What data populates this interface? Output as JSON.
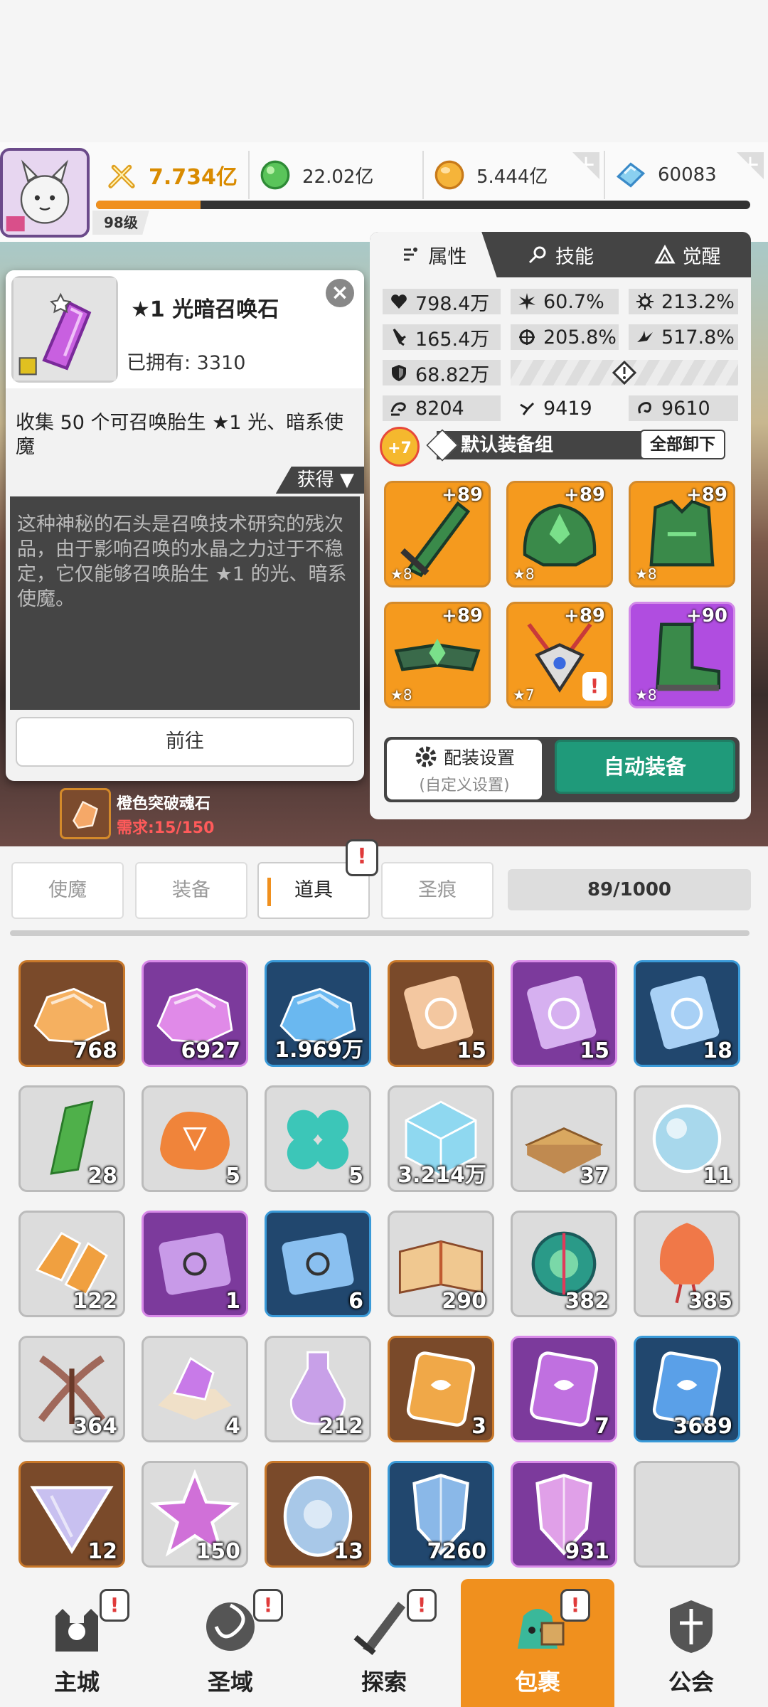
{
  "player": {
    "level": "98级"
  },
  "resources": {
    "power": "7.734亿",
    "green_gem": "22.02亿",
    "gold": "5.444亿",
    "diamond": "60083",
    "xp_progress": 0.16
  },
  "popup": {
    "title": "★1 光暗召唤石",
    "owned": "已拥有: 3310",
    "close": "×",
    "desc": "收集 50 个可召唤胎生 ★1 光、暗系使魔",
    "get_label": "获得 ▼",
    "lore": "这种神秘的石头是召唤技术研究的残次品，由于影响召唤的水晶之力过于不稳定，它仅能够召唤胎生 ★1 的光、暗系使魔。",
    "go_button": "前往"
  },
  "hint": {
    "name": "橙色突破魂石",
    "need": "需求:15/150"
  },
  "panel": {
    "tabs": [
      {
        "label": "属性",
        "icon": "attribute-icon"
      },
      {
        "label": "技能",
        "icon": "skill-icon"
      },
      {
        "label": "觉醒",
        "icon": "awaken-icon"
      }
    ],
    "stats": {
      "hp": "798.4万",
      "crit_rate": "60.7%",
      "crit_dmg": "213.2%",
      "atk": "165.4万",
      "accuracy": "205.8%",
      "speed_pct": "517.8%",
      "def": "68.82万",
      "s1": "8204",
      "s2": "9419",
      "s3": "9610"
    },
    "enhance": "+7",
    "equip_set": "默认装备组",
    "unequip_all": "全部卸下",
    "equipment": [
      {
        "level": "+89",
        "stars": "★8",
        "rarity": "orange",
        "icon": "sword-icon"
      },
      {
        "level": "+89",
        "stars": "★8",
        "rarity": "orange",
        "icon": "helmet-icon"
      },
      {
        "level": "+89",
        "stars": "★8",
        "rarity": "orange",
        "icon": "armor-icon"
      },
      {
        "level": "+89",
        "stars": "★8",
        "rarity": "orange",
        "icon": "belt-icon"
      },
      {
        "level": "+89",
        "stars": "★7",
        "rarity": "orange",
        "icon": "necklace-icon",
        "warn": "!"
      },
      {
        "level": "+90",
        "stars": "★8",
        "rarity": "purple",
        "icon": "boots-icon"
      }
    ],
    "config_label": "配装设置",
    "config_sub": "(自定义设置)",
    "auto_equip": "自动装备"
  },
  "inventory": {
    "categories": [
      "使魔",
      "装备",
      "道具",
      "圣痕"
    ],
    "active": "道具",
    "badge": "!",
    "capacity": "89/1000",
    "items": [
      {
        "count": "768",
        "rarity": "orange",
        "icon": "ore-icon",
        "color": "#f5b060"
      },
      {
        "count": "6927",
        "rarity": "purple",
        "icon": "ore-icon",
        "color": "#e08ae8"
      },
      {
        "count": "1.969万",
        "rarity": "blue",
        "icon": "ore-icon",
        "color": "#6ab8f0"
      },
      {
        "count": "15",
        "rarity": "orange",
        "icon": "scroll-icon",
        "color": "#f3c7a0"
      },
      {
        "count": "15",
        "rarity": "purple",
        "icon": "scroll-icon",
        "color": "#d6b0f0"
      },
      {
        "count": "18",
        "rarity": "blue",
        "icon": "scroll-icon",
        "color": "#a8d0f5"
      },
      {
        "count": "28",
        "rarity": "grey",
        "icon": "crystal-icon",
        "color": "#4fb04a"
      },
      {
        "count": "5",
        "rarity": "grey",
        "icon": "fire-scroll-icon",
        "color": "#f0843a"
      },
      {
        "count": "5",
        "rarity": "grey",
        "icon": "clover-icon",
        "color": "#3cc6b8"
      },
      {
        "count": "3.214万",
        "rarity": "grey",
        "icon": "cube-icon",
        "color": "#8fd8f0"
      },
      {
        "count": "37",
        "rarity": "grey",
        "icon": "book-icon",
        "color": "#d9a860"
      },
      {
        "count": "11",
        "rarity": "grey",
        "icon": "orb-icon",
        "color": "#a8d8ec"
      },
      {
        "count": "122",
        "rarity": "grey",
        "icon": "shard-icon",
        "color": "#f0a040"
      },
      {
        "count": "1",
        "rarity": "purple",
        "icon": "rune-scroll-icon",
        "color": "#c89ae8"
      },
      {
        "count": "6",
        "rarity": "blue",
        "icon": "rune-scroll-icon",
        "color": "#8ac0f0"
      },
      {
        "count": "290",
        "rarity": "grey",
        "icon": "open-book-icon",
        "color": "#f0c890"
      },
      {
        "count": "382",
        "rarity": "grey",
        "icon": "compass-icon",
        "color": "#2a9a88"
      },
      {
        "count": "385",
        "rarity": "grey",
        "icon": "lantern-icon",
        "color": "#f07848"
      },
      {
        "count": "364",
        "rarity": "grey",
        "icon": "crossbow-icon",
        "color": "#a0685a"
      },
      {
        "count": "4",
        "rarity": "grey",
        "icon": "gem-pile-icon",
        "color": "#c87ae8"
      },
      {
        "count": "212",
        "rarity": "grey",
        "icon": "potion-icon",
        "color": "#c8a0e8"
      },
      {
        "count": "3",
        "rarity": "orange",
        "icon": "card-icon",
        "color": "#f0a848"
      },
      {
        "count": "7",
        "rarity": "purple",
        "icon": "card-icon",
        "color": "#c070e0"
      },
      {
        "count": "3689",
        "rarity": "blue",
        "icon": "card-icon",
        "color": "#5aa0e8"
      },
      {
        "count": "12",
        "rarity": "orange",
        "icon": "prism-icon",
        "color": "#c8c0f0"
      },
      {
        "count": "150",
        "rarity": "grey",
        "icon": "star-icon",
        "color": "#d070d8"
      },
      {
        "count": "13",
        "rarity": "orange",
        "icon": "medallion-icon",
        "color": "#a8c8e8"
      },
      {
        "count": "7260",
        "rarity": "blue",
        "icon": "shield-shard-icon",
        "color": "#8ab8e8"
      },
      {
        "count": "931",
        "rarity": "purple",
        "icon": "shield-shard-icon",
        "color": "#e0a0e8"
      },
      {
        "count": "",
        "rarity": "empty",
        "icon": "",
        "color": ""
      }
    ]
  },
  "nav": [
    {
      "label": "主城",
      "badge": "!",
      "icon": "castle-icon"
    },
    {
      "label": "圣域",
      "badge": "!",
      "icon": "vortex-icon"
    },
    {
      "label": "探索",
      "badge": "!",
      "icon": "sword-explore-icon"
    },
    {
      "label": "包裹",
      "badge": "!",
      "icon": "bag-icon",
      "active": true
    },
    {
      "label": "公会",
      "badge": "",
      "icon": "guild-icon"
    }
  ]
}
